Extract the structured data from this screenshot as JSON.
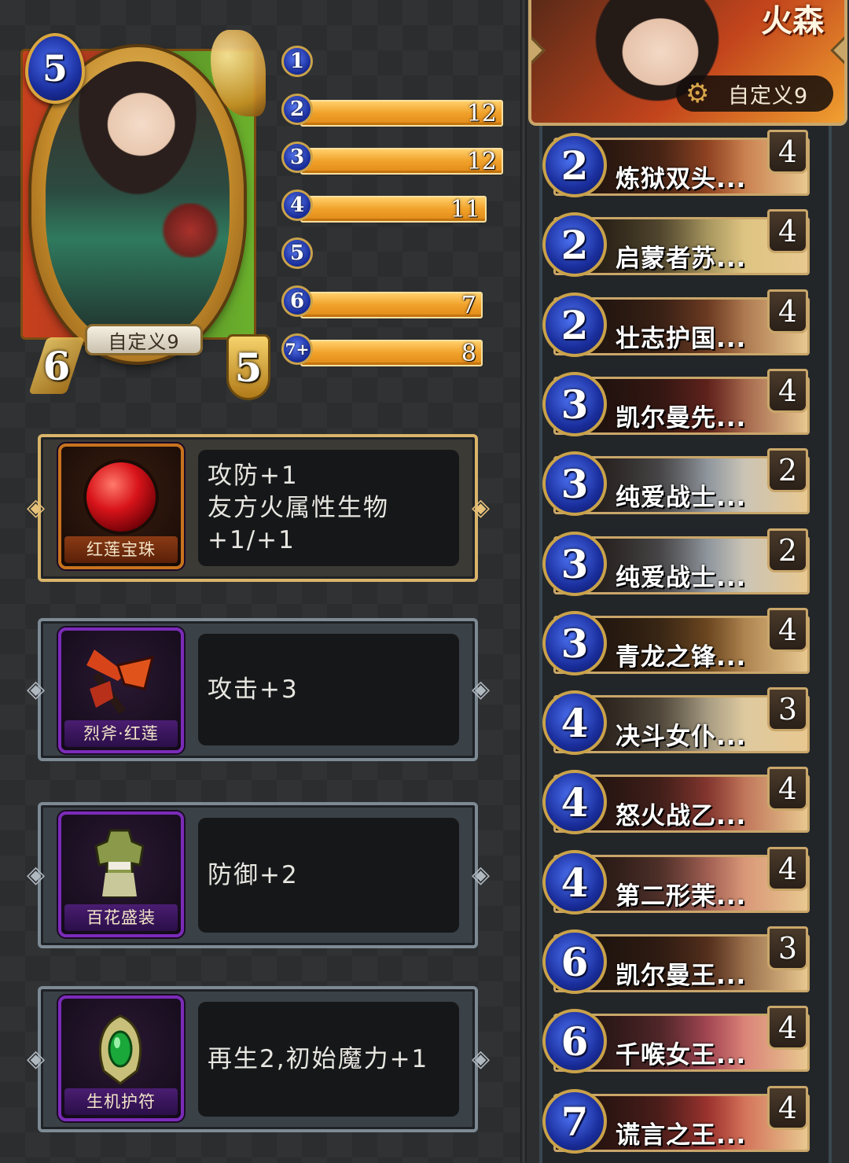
{
  "hero": {
    "cost": "5",
    "attack": "6",
    "defense": "5",
    "name": "自定义9"
  },
  "mana_curve": [
    {
      "cost": "1",
      "value": "",
      "fill": 0
    },
    {
      "cost": "2",
      "value": "12",
      "fill": 1.0
    },
    {
      "cost": "3",
      "value": "12",
      "fill": 1.0
    },
    {
      "cost": "4",
      "value": "11",
      "fill": 0.92
    },
    {
      "cost": "5",
      "value": "",
      "fill": 0
    },
    {
      "cost": "6",
      "value": "7",
      "fill": 0.9
    },
    {
      "cost": "7+",
      "value": "8",
      "fill": 0.9
    }
  ],
  "equipment": [
    {
      "name": "红莲宝珠",
      "effect": "攻防+1\n友方火属性生物+1/+1",
      "rarity": "gold",
      "icon": "red-orb-icon"
    },
    {
      "name": "烈斧·红莲",
      "effect": "攻击+3",
      "rarity": "purple",
      "icon": "axe-icon"
    },
    {
      "name": "百花盛装",
      "effect": "防御+2",
      "rarity": "purple",
      "icon": "armor-icon"
    },
    {
      "name": "生机护符",
      "effect": "再生2,初始魔力+1",
      "rarity": "purple",
      "icon": "amulet-icon"
    }
  ],
  "deck": {
    "faction": "火森",
    "name": "自定义9",
    "cards": [
      {
        "cost": "2",
        "name": "炼狱双头...",
        "count": "4",
        "color": "#b8552a"
      },
      {
        "cost": "2",
        "name": "启蒙者苏...",
        "count": "4",
        "color": "#d8c27a"
      },
      {
        "cost": "2",
        "name": "壮志护国...",
        "count": "4",
        "color": "#8a4a2a"
      },
      {
        "cost": "3",
        "name": "凯尔曼先...",
        "count": "4",
        "color": "#7a2a22"
      },
      {
        "cost": "3",
        "name": "纯爱战士...",
        "count": "2",
        "color": "#b9c2cc"
      },
      {
        "cost": "3",
        "name": "纯爱战士...",
        "count": "2",
        "color": "#b9c2cc"
      },
      {
        "cost": "3",
        "name": "青龙之锋...",
        "count": "4",
        "color": "#8a5a28"
      },
      {
        "cost": "4",
        "name": "决斗女仆...",
        "count": "3",
        "color": "#d8caa8"
      },
      {
        "cost": "4",
        "name": "怒火战乙...",
        "count": "4",
        "color": "#a8443a"
      },
      {
        "cost": "4",
        "name": "第二形茉...",
        "count": "4",
        "color": "#d07a6a"
      },
      {
        "cost": "6",
        "name": "凯尔曼王...",
        "count": "3",
        "color": "#6a3a22"
      },
      {
        "cost": "6",
        "name": "千喉女王...",
        "count": "4",
        "color": "#d25a6a"
      },
      {
        "cost": "7",
        "name": "谎言之王...",
        "count": "4",
        "color": "#c8403a"
      }
    ]
  }
}
